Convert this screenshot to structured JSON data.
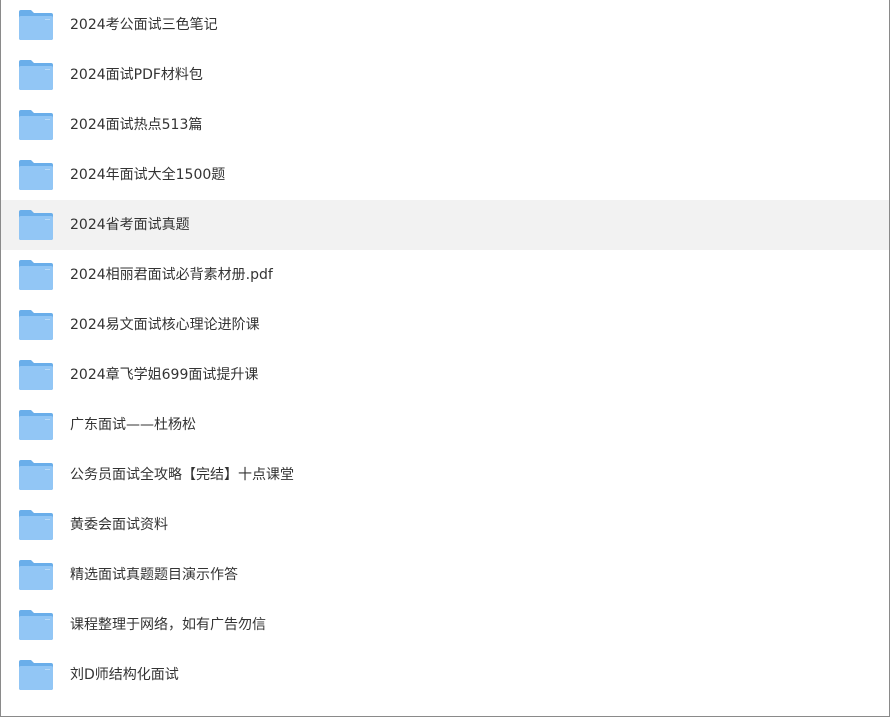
{
  "colors": {
    "folder_front": "#92c6f5",
    "folder_back": "#6aaeea",
    "row_hover": "#f2f2f2",
    "text": "#333333"
  },
  "hovered_index": 4,
  "files": [
    {
      "name": "2024考公面试三色笔记",
      "icon": "folder-icon"
    },
    {
      "name": "2024面试PDF材料包",
      "icon": "folder-icon"
    },
    {
      "name": "2024面试热点513篇",
      "icon": "folder-icon"
    },
    {
      "name": "2024年面试大全1500题",
      "icon": "folder-icon"
    },
    {
      "name": "2024省考面试真题",
      "icon": "folder-icon"
    },
    {
      "name": "2024相丽君面试必背素材册.pdf",
      "icon": "folder-icon"
    },
    {
      "name": "2024易文面试核心理论进阶课",
      "icon": "folder-icon"
    },
    {
      "name": "2024章飞学姐699面试提升课",
      "icon": "folder-icon"
    },
    {
      "name": "广东面试——杜杨松",
      "icon": "folder-icon"
    },
    {
      "name": "公务员面试全攻略【完结】十点课堂",
      "icon": "folder-icon"
    },
    {
      "name": "黄委会面试资料",
      "icon": "folder-icon"
    },
    {
      "name": "精选面试真题题目演示作答",
      "icon": "folder-icon"
    },
    {
      "name": "课程整理于网络，如有广告勿信",
      "icon": "folder-icon"
    },
    {
      "name": "刘D师结构化面试",
      "icon": "folder-icon"
    }
  ]
}
